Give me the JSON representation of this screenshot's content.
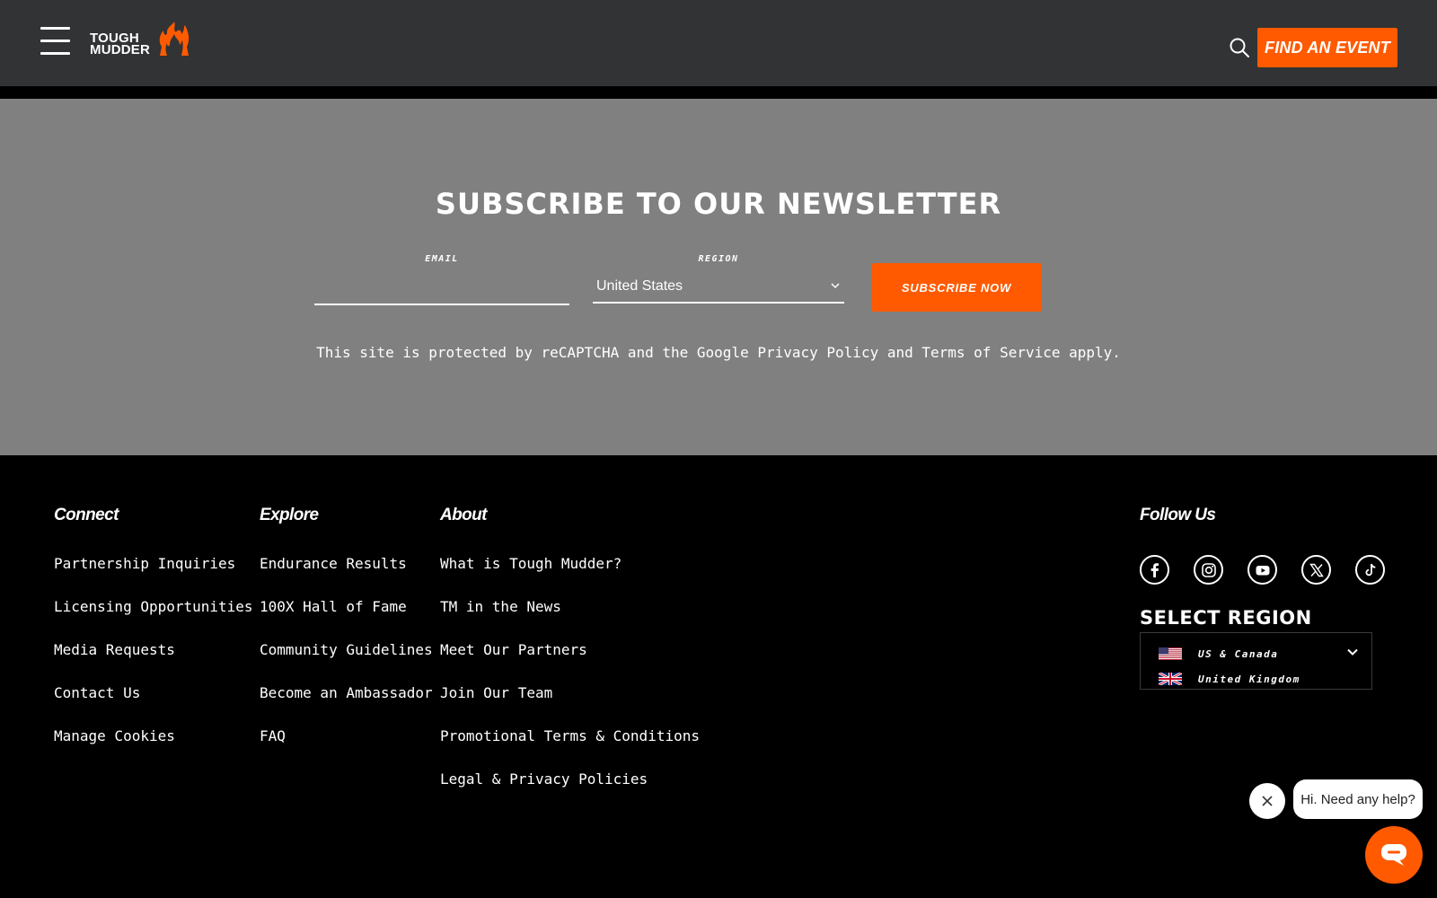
{
  "header": {
    "logo_text_line1": "TOUGH",
    "logo_text_line2": "MUDDER",
    "find_event_label": "FIND AN EVENT",
    "icons": [
      "menu-icon",
      "search-icon",
      "flame-logo-icon"
    ]
  },
  "newsletter": {
    "title": "SUBSCRIBE TO OUR NEWSLETTER",
    "email_label": "EMAIL",
    "email_value": "",
    "region_label": "REGION",
    "region_value": "United States",
    "subscribe_label": "SUBSCRIBE NOW",
    "recaptcha_prefix": "This site is protected by reCAPTCHA and the Google ",
    "privacy_link": "Privacy Policy",
    "recaptcha_and": " and ",
    "terms_link": "Terms of Service",
    "recaptcha_suffix": " apply."
  },
  "footer": {
    "connect": {
      "heading": "Connect",
      "items": [
        "Partnership Inquiries",
        "Licensing Opportunities",
        "Media Requests",
        "Contact Us",
        "Manage Cookies"
      ]
    },
    "explore": {
      "heading": "Explore",
      "items": [
        "Endurance Results",
        "100X Hall of Fame",
        "Community Guidelines",
        "Become an Ambassador",
        "FAQ"
      ]
    },
    "about": {
      "heading": "About",
      "items": [
        "What is Tough Mudder?",
        "TM in the News",
        "Meet Our Partners",
        "Join Our Team",
        "Promotional Terms & Conditions",
        "Legal & Privacy Policies"
      ]
    },
    "follow": {
      "heading": "Follow Us",
      "social_icons": [
        "facebook-icon",
        "instagram-icon",
        "youtube-icon",
        "x-twitter-icon",
        "tiktok-icon"
      ]
    },
    "select_region": {
      "title": "SELECT REGION",
      "options": [
        "US & Canada",
        "United Kingdom"
      ]
    }
  },
  "chat": {
    "bubble_text": "Hi. Need any help?"
  },
  "colors": {
    "accent": "#ff5a00",
    "header_bg": "#323335",
    "newsletter_bg": "#808080",
    "footer_bg": "#000000"
  }
}
